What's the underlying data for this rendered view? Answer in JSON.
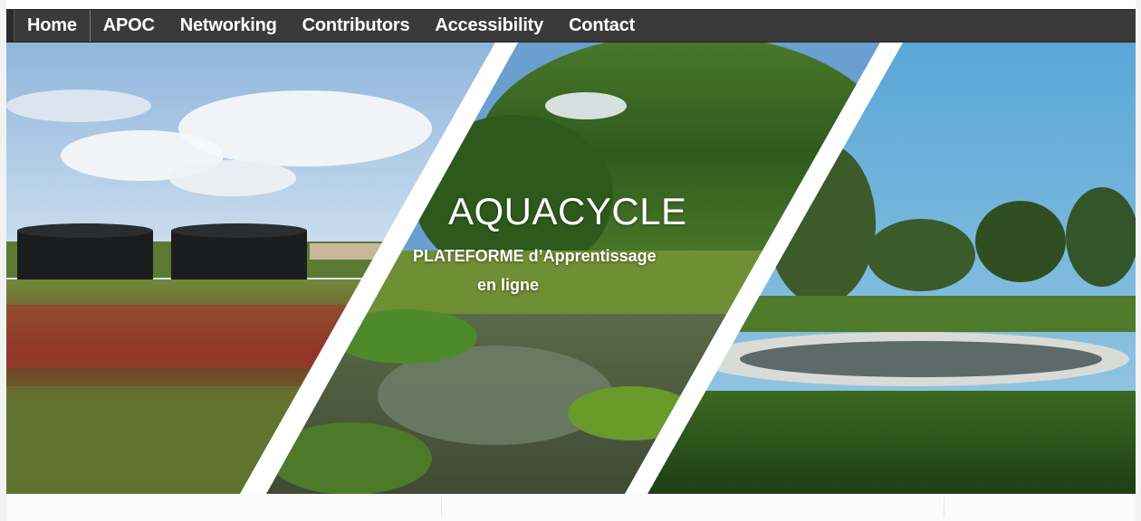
{
  "nav": {
    "items": [
      {
        "label": "Home",
        "active": true
      },
      {
        "label": "APOC"
      },
      {
        "label": "Networking"
      },
      {
        "label": "Contributors"
      },
      {
        "label": "Accessibility"
      },
      {
        "label": "Contact"
      }
    ]
  },
  "hero": {
    "title": "AQUACYCLE",
    "subtitle_line1": "PLATEFORME d’Apprentissage",
    "subtitle_line2": "en ligne"
  },
  "colors": {
    "nav_background": "#3a3a3a",
    "nav_text": "#ffffff",
    "hero_text": "#ffffff"
  }
}
